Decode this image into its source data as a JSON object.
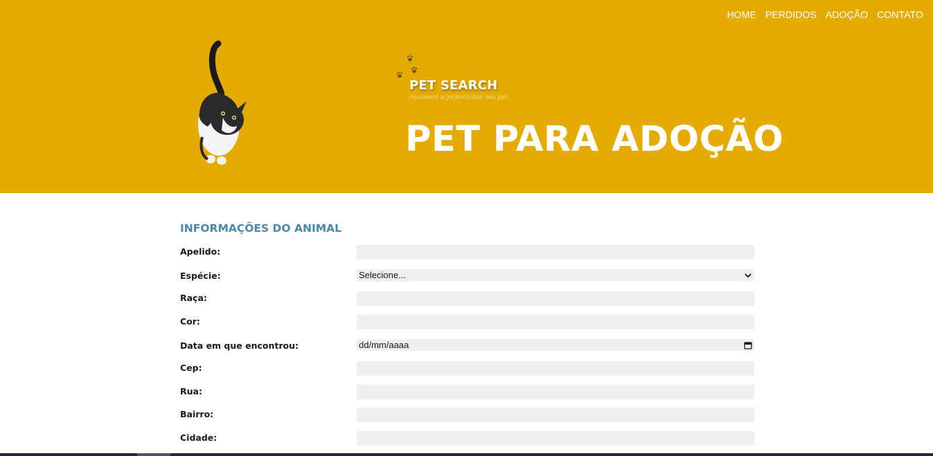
{
  "nav": {
    "items": [
      "HOME",
      "PERDIDOS",
      "ADOÇÃO",
      "CONTATO"
    ]
  },
  "brand": {
    "title": "PET SEARCH",
    "subtitle": "Ajudamos a [re]encontrar seu pet."
  },
  "hero": {
    "title": "PET PARA ADOÇÃO"
  },
  "form": {
    "section_title": "INFORMAÇÕES DO ANIMAL",
    "fields": [
      {
        "label": "Apelido:",
        "type": "text",
        "value": ""
      },
      {
        "label": "Espécie:",
        "type": "select",
        "value": "Selecione..."
      },
      {
        "label": "Raça:",
        "type": "text",
        "value": ""
      },
      {
        "label": "Cor:",
        "type": "text",
        "value": ""
      },
      {
        "label": "Data em que encontrou:",
        "type": "date",
        "value": "dd/mm/aaaa"
      },
      {
        "label": "Cep:",
        "type": "text",
        "value": ""
      },
      {
        "label": "Rua:",
        "type": "text",
        "value": ""
      },
      {
        "label": "Bairro:",
        "type": "text",
        "value": ""
      },
      {
        "label": "Cidade:",
        "type": "text",
        "value": ""
      }
    ]
  },
  "colors": {
    "hero_bg": "#e4ab03",
    "section_title": "#4a87ab",
    "field_bg": "#efefef"
  },
  "icons": [
    "cat-photo",
    "paw-prints-icon",
    "chevron-down-icon",
    "calendar-icon"
  ]
}
